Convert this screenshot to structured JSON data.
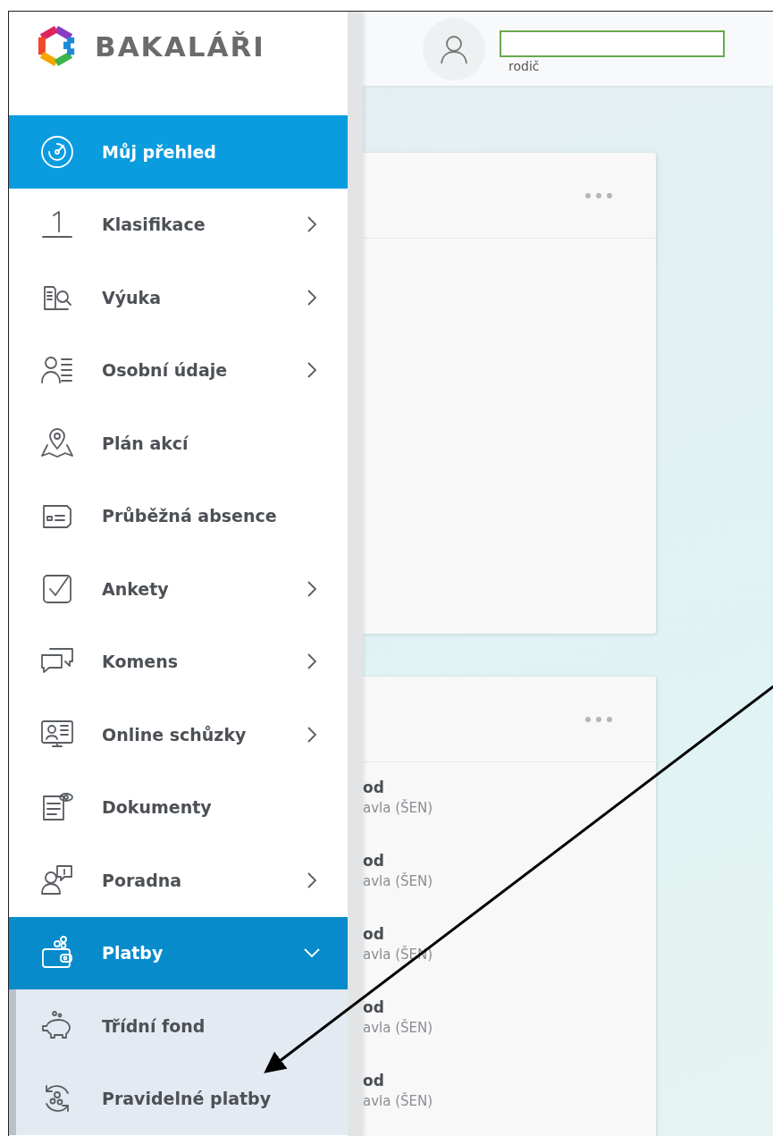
{
  "brand": {
    "name": "BAKALÁŘI"
  },
  "user": {
    "role": "rodič"
  },
  "sidebar": {
    "items": [
      {
        "label": "Můj přehled",
        "selected": true,
        "has_submenu": false,
        "expanded": false
      },
      {
        "label": "Klasifikace",
        "selected": false,
        "has_submenu": true,
        "expanded": false
      },
      {
        "label": "Výuka",
        "selected": false,
        "has_submenu": true,
        "expanded": false
      },
      {
        "label": "Osobní údaje",
        "selected": false,
        "has_submenu": true,
        "expanded": false
      },
      {
        "label": "Plán akcí",
        "selected": false,
        "has_submenu": false,
        "expanded": false
      },
      {
        "label": "Průběžná absence",
        "selected": false,
        "has_submenu": false,
        "expanded": false
      },
      {
        "label": "Ankety",
        "selected": false,
        "has_submenu": true,
        "expanded": false
      },
      {
        "label": "Komens",
        "selected": false,
        "has_submenu": true,
        "expanded": false
      },
      {
        "label": "Online schůzky",
        "selected": false,
        "has_submenu": true,
        "expanded": false
      },
      {
        "label": "Dokumenty",
        "selected": false,
        "has_submenu": false,
        "expanded": false
      },
      {
        "label": "Poradna",
        "selected": false,
        "has_submenu": true,
        "expanded": false
      },
      {
        "label": "Platby",
        "selected": false,
        "has_submenu": true,
        "expanded": true,
        "children": [
          {
            "label": "Třídní fond",
            "selected": false
          },
          {
            "label": "Pravidelné platby",
            "selected": false
          }
        ]
      }
    ]
  },
  "cards": [
    {
      "kind": "blank"
    },
    {
      "kind": "list",
      "rows": [
        {
          "title": "od",
          "subtitle": "avla (ŠEN)"
        },
        {
          "title": "od",
          "subtitle": "avla (ŠEN)"
        },
        {
          "title": "od",
          "subtitle": "avla (ŠEN)"
        },
        {
          "title": "od",
          "subtitle": "avla (ŠEN)"
        },
        {
          "title": "od",
          "subtitle": "avla (ŠEN)"
        }
      ]
    }
  ]
}
